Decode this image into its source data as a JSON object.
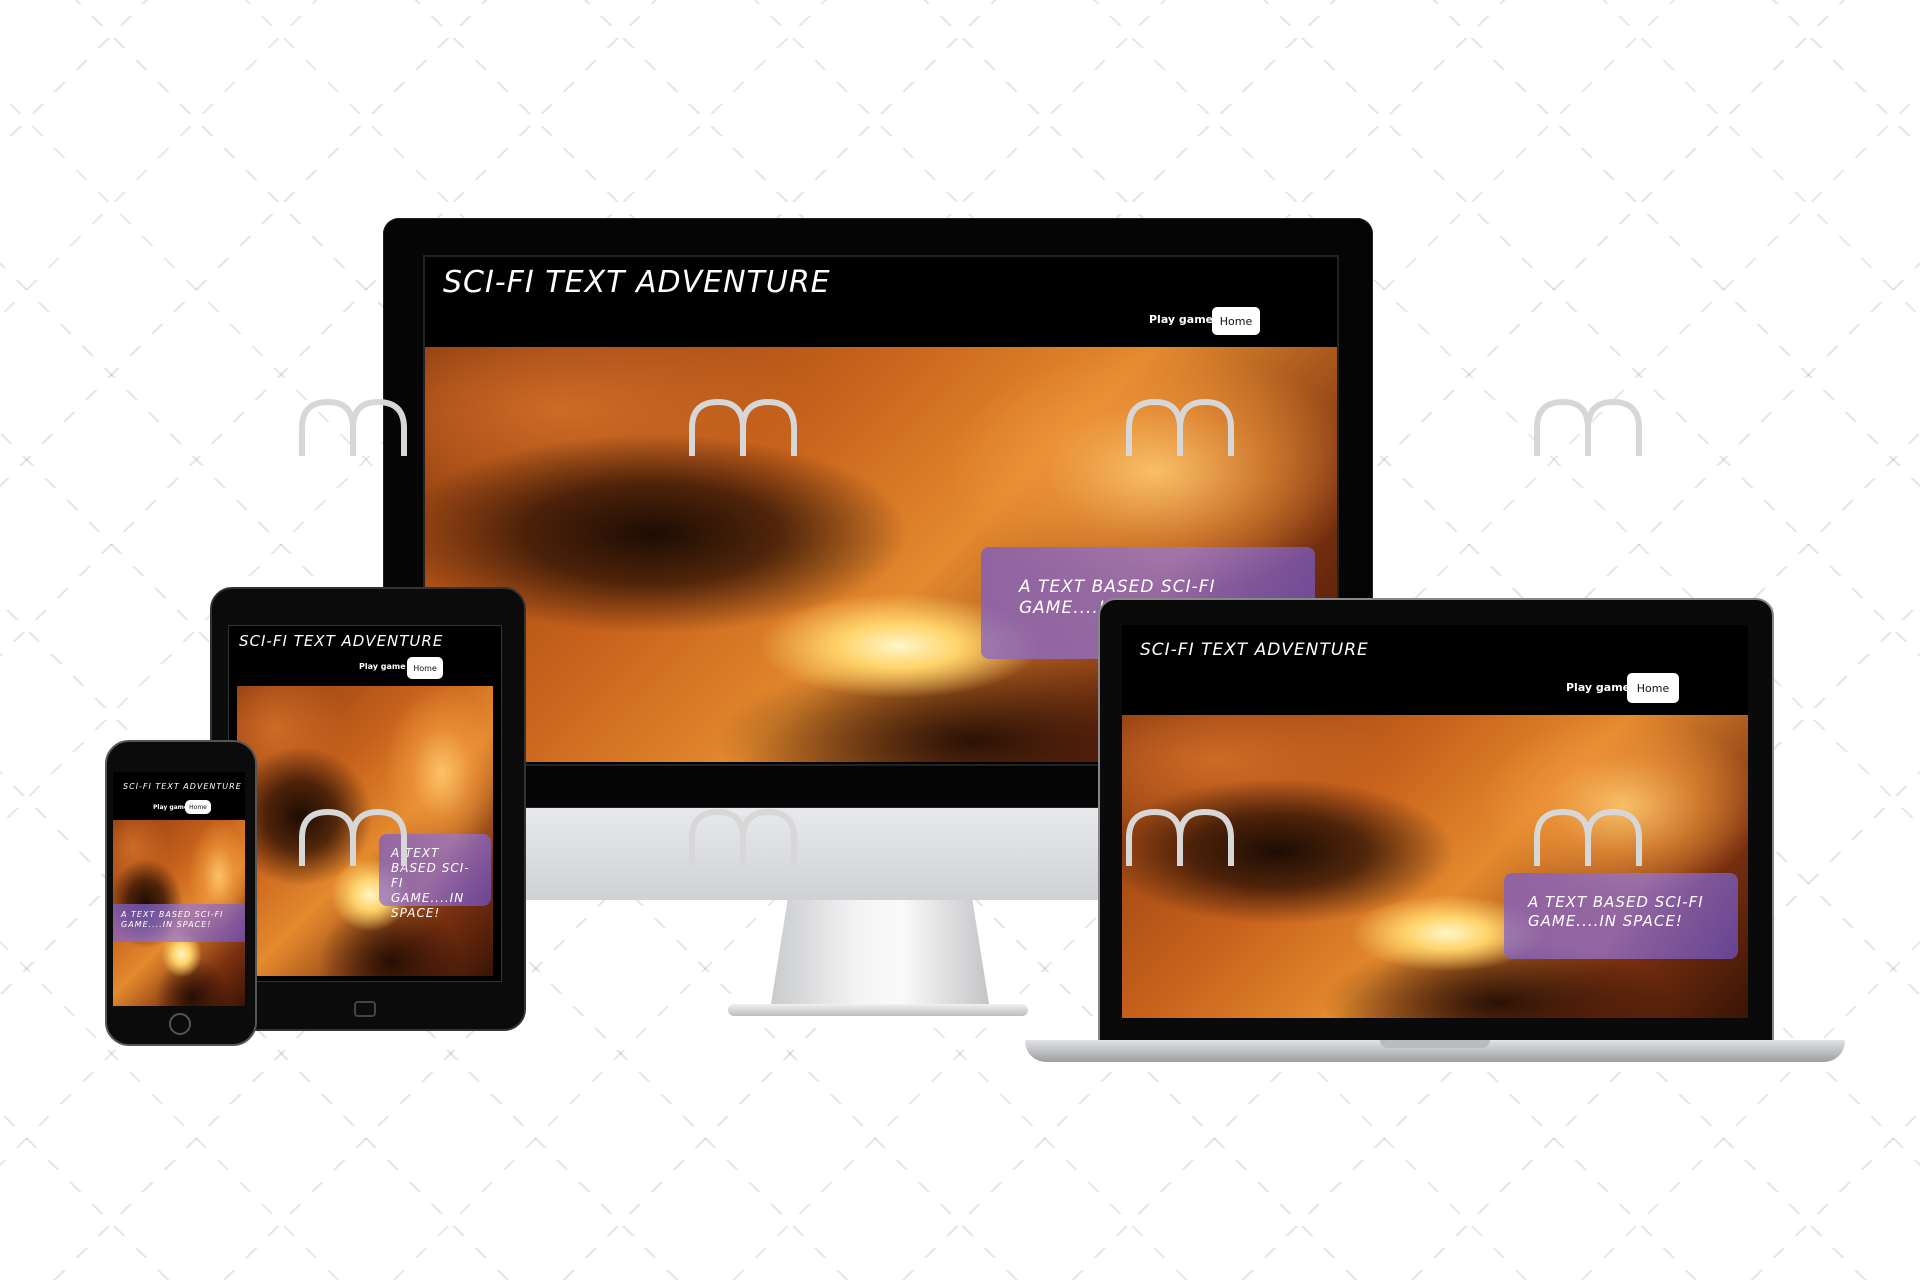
{
  "site": {
    "title": "SCI-FI TEXT ADVENTURE",
    "nav": {
      "play_label": "Play game",
      "home_label": "Home"
    },
    "tagline": "A TEXT BASED SCI-FI GAME....IN SPACE!"
  },
  "colors": {
    "background": "#ffffff",
    "header": "#000000",
    "tagline_box": "#8f72d6",
    "nebula_primary": "#e48a2e"
  },
  "icons": {
    "watermark": "m-logo-watermark"
  }
}
